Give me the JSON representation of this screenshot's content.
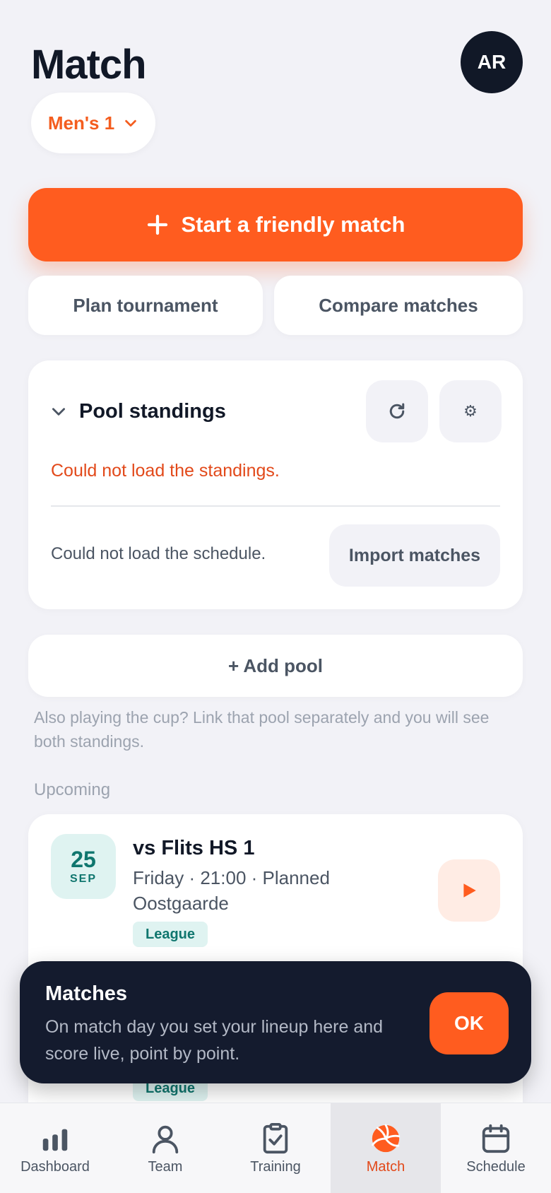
{
  "header": {
    "title": "Match",
    "avatar_initials": "AR",
    "team_selector": "Men's 1"
  },
  "actions": {
    "primary": "Start a friendly match",
    "plan_tournament": "Plan tournament",
    "compare_matches": "Compare matches"
  },
  "pool": {
    "title": "Pool standings",
    "standings_error": "Could not load the standings.",
    "schedule_error": "Could not load the schedule.",
    "import_button": "Import matches"
  },
  "add_pool": {
    "label": "+ Add pool",
    "hint": "Also playing the cup? Link that pool separately and you will see both standings."
  },
  "upcoming": {
    "section_label": "Upcoming",
    "matches": [
      {
        "day": "25",
        "month": "SEP",
        "opponent": "vs Flits HS 1",
        "when": "Friday · 21:00 · Planned",
        "location": "Oostgaarde",
        "tag": "League"
      },
      {
        "tag": "League"
      }
    ]
  },
  "toast": {
    "title": "Matches",
    "body": "On match day you set your lineup here and score live, point by point.",
    "ok": "OK"
  },
  "nav": {
    "items": [
      {
        "label": "Dashboard",
        "icon": "bar-chart-icon"
      },
      {
        "label": "Team",
        "icon": "person-icon"
      },
      {
        "label": "Training",
        "icon": "clipboard-check-icon"
      },
      {
        "label": "Match",
        "icon": "volleyball-icon",
        "active": true
      },
      {
        "label": "Schedule",
        "icon": "calendar-icon"
      }
    ]
  },
  "colors": {
    "accent": "#ff5c1f",
    "dark": "#111827",
    "teal": "#0f766e",
    "error": "#e2491a",
    "background": "#f2f2f7"
  }
}
